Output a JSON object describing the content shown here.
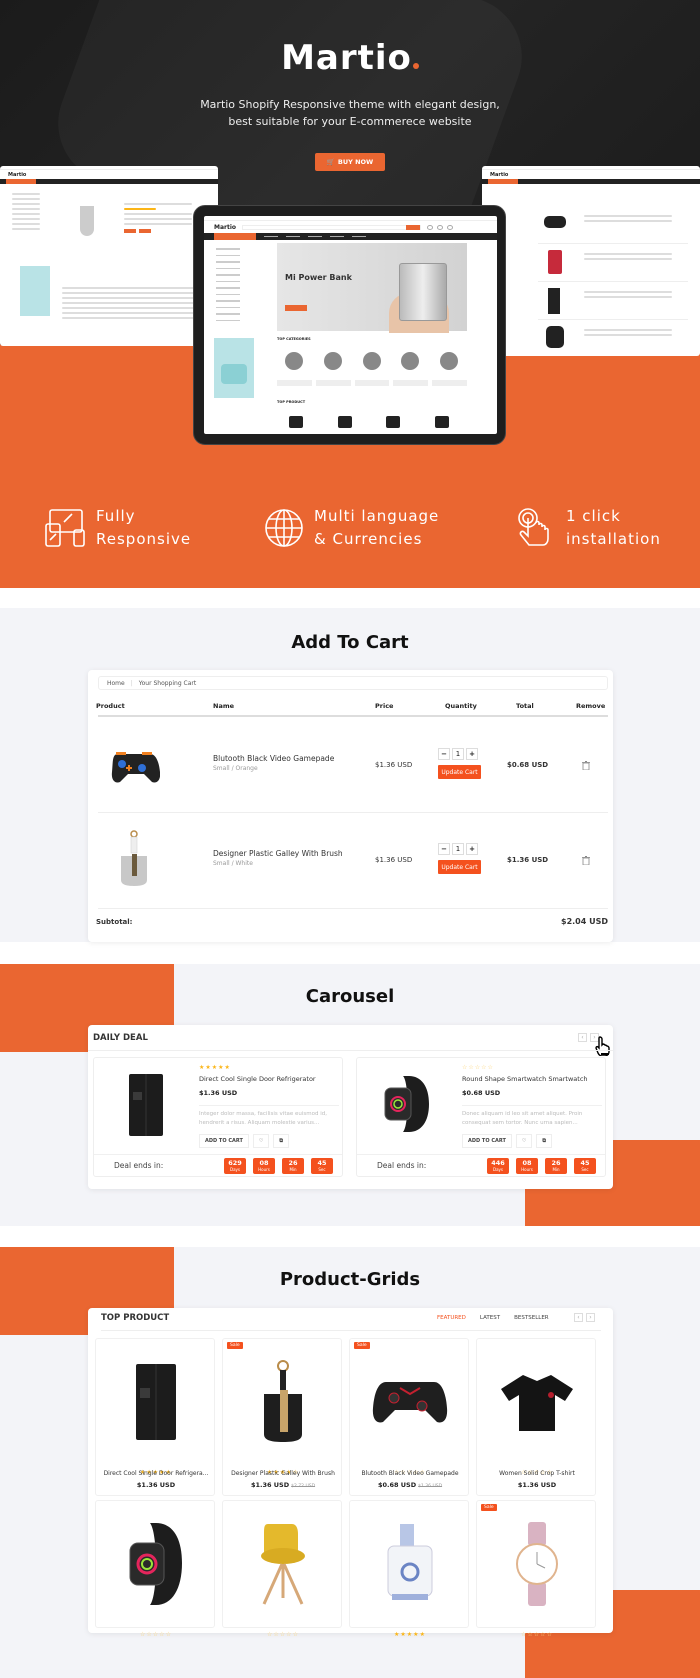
{
  "hero": {
    "brand": "Martio",
    "tagline_line1": "Martio Shopify Responsive theme with elegant design,",
    "tagline_line2": "best suitable for your E-commerece website",
    "buy_button": "BUY NOW",
    "colors": {
      "accent": "#ea6631",
      "dark": "#1b1b1b"
    }
  },
  "tablet_mockup": {
    "logo": "Martio",
    "banner_title": "Mi Power Bank",
    "top_categories_label": "TOP CATEGORIES",
    "top_product_label": "TOP PRODUCT"
  },
  "side_mockups": {
    "left_logo": "Martio",
    "right_logo": "Martio"
  },
  "features": [
    {
      "icon": "responsive-devices-icon",
      "line1": "Fully",
      "line2": "Responsive"
    },
    {
      "icon": "globe-icon",
      "line1": "Multi language",
      "line2": "& Currencies"
    },
    {
      "icon": "tap-hand-icon",
      "line1": "1 click",
      "line2": "installation"
    }
  ],
  "cart": {
    "section_title": "Add To Cart",
    "breadcrumb": [
      "Home",
      "Your Shopping Cart"
    ],
    "headers": [
      "Product",
      "Name",
      "Price",
      "Quantity",
      "Total",
      "Remove"
    ],
    "update_label": "Update Cart",
    "items": [
      {
        "name": "Blutooth Black Video Gamepade",
        "variant": "Small / Orange",
        "price": "$1.36 USD",
        "qty": "1",
        "total": "$0.68 USD"
      },
      {
        "name": "Designer Plastic Galley With Brush",
        "variant": "Small / White",
        "price": "$1.36 USD",
        "qty": "1",
        "total": "$1.36 USD"
      }
    ],
    "subtotal_label": "Subtotal:",
    "subtotal_value": "$2.04 USD"
  },
  "carousel": {
    "section_title": "Carousel",
    "block_title": "DAILY DEAL",
    "add_to_cart": "ADD TO CART",
    "deal_ends_label": "Deal ends in:",
    "deals": [
      {
        "name": "Direct Cool Single Door Refrigerator",
        "price": "$1.36 USD",
        "rating": 5,
        "desc": "Integer dolor massa, facilisis vitae euismod id, hendrerit a risus. Aliquam molestie varius...",
        "timer": [
          {
            "v": "629",
            "u": "Days"
          },
          {
            "v": "08",
            "u": "Hours"
          },
          {
            "v": "26",
            "u": "Min"
          },
          {
            "v": "45",
            "u": "Sec"
          }
        ]
      },
      {
        "name": "Round Shape Smartwatch Smartwatch",
        "price": "$0.68 USD",
        "rating": 0,
        "desc": "Donec aliquam id leo sit amet aliquet. Proin consequat sem tortor. Nunc urna sapien...",
        "timer": [
          {
            "v": "446",
            "u": "Days"
          },
          {
            "v": "08",
            "u": "Hours"
          },
          {
            "v": "26",
            "u": "Min"
          },
          {
            "v": "45",
            "u": "Sec"
          }
        ]
      }
    ]
  },
  "grid": {
    "section_title": "Product-Grids",
    "block_title": "TOP PRODUCT",
    "tabs": [
      "FEATURED",
      "LATEST",
      "BESTSELLER"
    ],
    "active_tab": "FEATURED",
    "sale_label": "Sale",
    "products": [
      {
        "name": "Direct Cool Single Door Refrigera...",
        "price": "$1.36 USD",
        "old": "",
        "rating": 5,
        "sale": false,
        "img": "fridge"
      },
      {
        "name": "Designer Plastic Galley With Brush",
        "price": "$1.36 USD",
        "old": "$2.72 USD",
        "rating": 4,
        "sale": true,
        "img": "dustpan"
      },
      {
        "name": "Blutooth Black Video Gamepade",
        "price": "$0.68 USD",
        "old": "$1.36 USD",
        "rating": 0,
        "sale": true,
        "img": "gamepad"
      },
      {
        "name": "Women Solid Crop T-shirt",
        "price": "$1.36 USD",
        "old": "",
        "rating": 0,
        "sale": false,
        "img": "tshirt"
      },
      {
        "name": "",
        "price": "",
        "old": "",
        "rating": 0,
        "sale": false,
        "img": "watch"
      },
      {
        "name": "",
        "price": "",
        "old": "",
        "rating": 0,
        "sale": false,
        "img": "chair"
      },
      {
        "name": "",
        "price": "",
        "old": "",
        "rating": 5,
        "sale": false,
        "img": "juicer"
      },
      {
        "name": "",
        "price": "",
        "old": "",
        "rating": 0,
        "sale": true,
        "img": "wristwatch"
      }
    ]
  }
}
